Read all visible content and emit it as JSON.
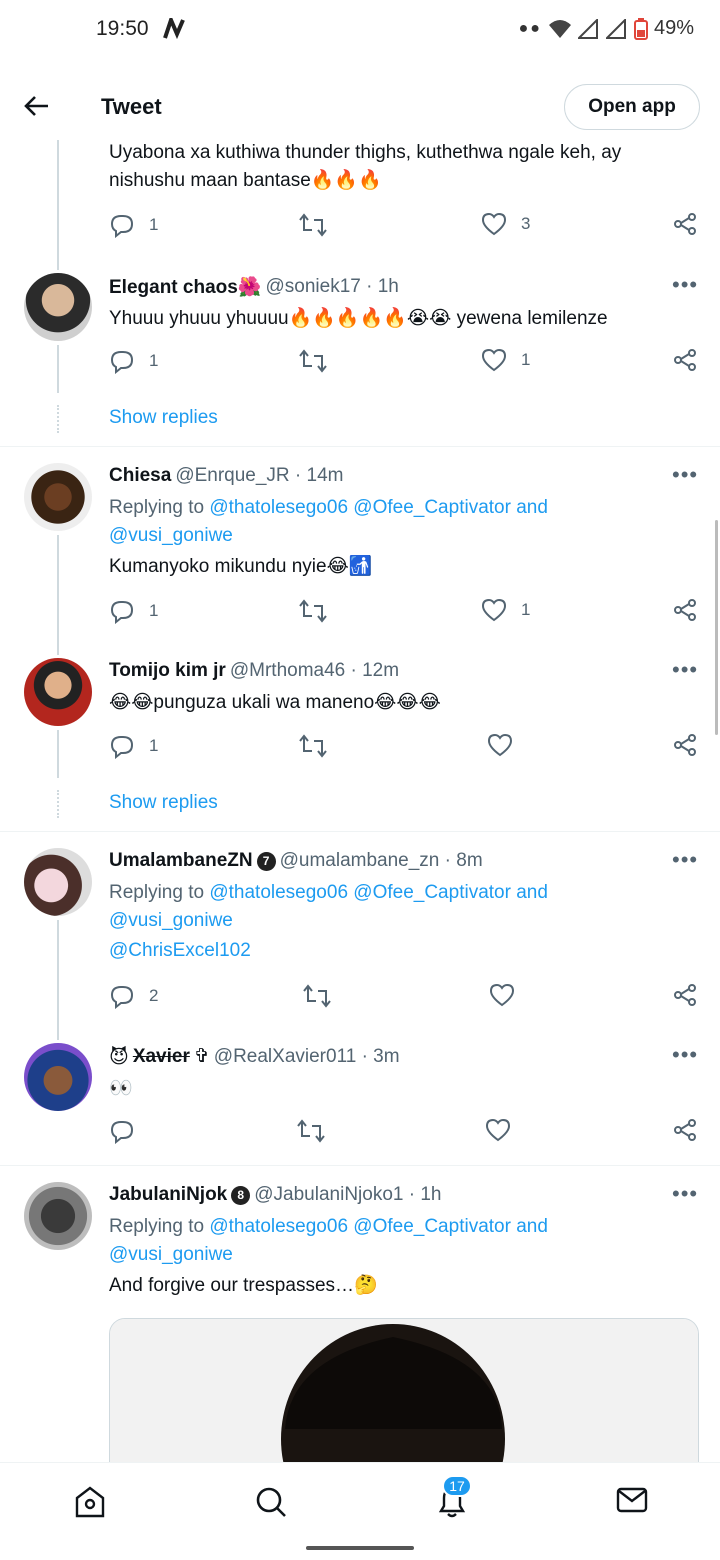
{
  "status_bar": {
    "time": "19:50",
    "battery": "49%"
  },
  "header": {
    "title": "Tweet",
    "open_app": "Open app"
  },
  "tweets": [
    {
      "text": "Uyabona xa kuthiwa thunder thighs, kuthethwa ngale keh, ay nishushu maan bantase🔥🔥🔥",
      "replies": "1",
      "retweets": "",
      "likes": "3"
    },
    {
      "name": "Elegant chaos🌺",
      "handle": "@soniek17 · 1h",
      "text": "Yhuuu yhuuu yhuuuu🔥🔥🔥🔥🔥😭😭 yewena lemilenze",
      "replies": "1",
      "retweets": "",
      "likes": "1",
      "show_replies": "Show replies"
    },
    {
      "name": "Chiesa",
      "handle": "@Enrque_JR · 14m",
      "replying_prefix": "Replying to ",
      "replying_to": "@thatolesego06 @Ofee_Captivator and",
      "replying_to_2": "@vusi_goniwe",
      "text": "Kumanyoko mikundu nyie😂🚮",
      "replies": "1",
      "retweets": "",
      "likes": "1"
    },
    {
      "name": "Tomijo kim jr",
      "handle": "@Mrthoma46 · 12m",
      "text": "😂😂punguza ukali wa maneno😂😂😂",
      "replies": "1",
      "retweets": "",
      "likes": "",
      "show_replies": "Show replies"
    },
    {
      "name": "UmalambaneZN",
      "badge": "7",
      "handle": "@umalambane_zn · 8m",
      "replying_prefix": "Replying to ",
      "replying_to": "@thatolesego06 @Ofee_Captivator and",
      "replying_to_2": "@vusi_goniwe",
      "text": "@ChrisExcel102",
      "replies": "2",
      "retweets": "",
      "likes": ""
    },
    {
      "name_prefix": "😈",
      "name": "Xavier",
      "name_suffix": "✞",
      "handle": "@RealXavier011 · 3m",
      "text": "👀",
      "replies": "",
      "retweets": "",
      "likes": ""
    },
    {
      "name": "JabulaniNjok",
      "badge": "8",
      "handle": "@JabulaniNjoko1 · 1h",
      "replying_prefix": "Replying to ",
      "replying_to": "@thatolesego06 @Ofee_Captivator and",
      "replying_to_2": "@vusi_goniwe",
      "text": "And forgive our trespasses…🤔"
    }
  ],
  "bottom_nav": {
    "notifications_count": "17"
  },
  "icons": [
    "back-arrow-icon",
    "reply-icon",
    "retweet-icon",
    "like-icon",
    "share-icon",
    "more-icon",
    "home-icon",
    "search-icon",
    "bell-icon",
    "mail-icon"
  ],
  "colors": {
    "accent": "#1d9bf0",
    "secondary_text": "#536471",
    "border": "#cfd9de"
  }
}
